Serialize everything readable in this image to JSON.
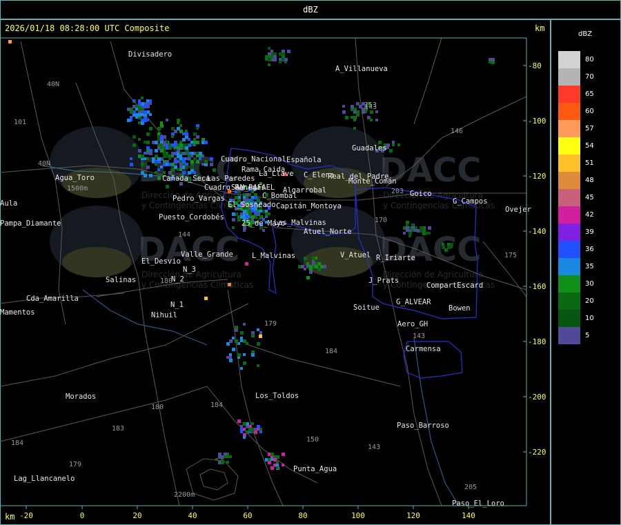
{
  "window": {
    "title": "dBZ",
    "header": "2026/01/18 08:28:00 UTC Composite",
    "km_top": "km",
    "km_bottom": "km"
  },
  "legend": {
    "title": "dBZ",
    "entries": [
      {
        "label": "80",
        "color": "#d2d2d2"
      },
      {
        "label": "70",
        "color": "#b4b4b4"
      },
      {
        "label": "65",
        "color": "#ff3a2a"
      },
      {
        "label": "60",
        "color": "#ff5a10"
      },
      {
        "label": "57",
        "color": "#ff9a5a"
      },
      {
        "label": "54",
        "color": "#ffff10"
      },
      {
        "label": "51",
        "color": "#ffc02a"
      },
      {
        "label": "48",
        "color": "#dd8a3a"
      },
      {
        "label": "45",
        "color": "#c8607a"
      },
      {
        "label": "42",
        "color": "#d020a0"
      },
      {
        "label": "39",
        "color": "#8020e0"
      },
      {
        "label": "36",
        "color": "#2050ff"
      },
      {
        "label": "35",
        "color": "#1888e0"
      },
      {
        "label": "30",
        "color": "#10901a"
      },
      {
        "label": "20",
        "color": "#0a6a12"
      },
      {
        "label": "10",
        "color": "#065510"
      },
      {
        "label": "5",
        "color": "#504898"
      }
    ]
  },
  "axes": {
    "x_ticks": [
      "-20",
      "0",
      "20",
      "40",
      "60",
      "80",
      "100",
      "120",
      "140"
    ],
    "y_ticks": [
      "-80",
      "-100",
      "-120",
      "-140",
      "-160",
      "-180",
      "-200",
      "-220"
    ]
  },
  "places": [
    "Divisadero",
    "A_Villanueva",
    "Guadales",
    "Agua_Toro",
    "Aula",
    "Pampa_Diamante",
    "Los_Toldos",
    "Punta_Agua",
    "Morados",
    "Lag_Llancanelo",
    "Paso_Barroso",
    "Paso_El_Loro",
    "Soitue",
    "Bowen",
    "Carmensa",
    "Aero_GH",
    "G_ALVEAR",
    "CompartEscard",
    "J_Prats",
    "V_Atuel",
    "R_Iriarte",
    "Atuel_Norte",
    "Goico",
    "G_Campos",
    "Ovejer",
    "El_Desvio",
    "Salinas",
    "Cda_Amarilla",
    "Mamentos",
    "Nihuil",
    "N_1",
    "N_2",
    "N_3",
    "Valle_Grande",
    "L_Malvinas",
    "Cuadro_Benegas",
    "Pedro_Vargas",
    "Cañada_Seca",
    "C_Bombal",
    "La_Llave",
    "Algarrobal",
    "Rama_Caida",
    "Española",
    "C_Elena",
    "Real_del_Padre",
    "Monte_Comán",
    "Capitán_Montoya",
    "SAN_RAFAEL",
    "Las_Paredes",
    "Cuadro_Nacional",
    "Las_Malvinas",
    "25_de_Mayo",
    "El_Sosneado",
    "Puesto_Cordobés"
  ],
  "route_numbers": [
    "101",
    "40N",
    "40N",
    "144",
    "143",
    "143",
    "153",
    "146",
    "203",
    "170",
    "179",
    "184",
    "180",
    "180",
    "184",
    "183",
    "179",
    "150",
    "143",
    "205",
    "175",
    "184"
  ],
  "elevations": [
    "1500m",
    "2200m"
  ],
  "watermark": {
    "brand": "DACC",
    "line1": "Dirección de Agricultura",
    "line2": "y Contingencias Climáticas"
  }
}
